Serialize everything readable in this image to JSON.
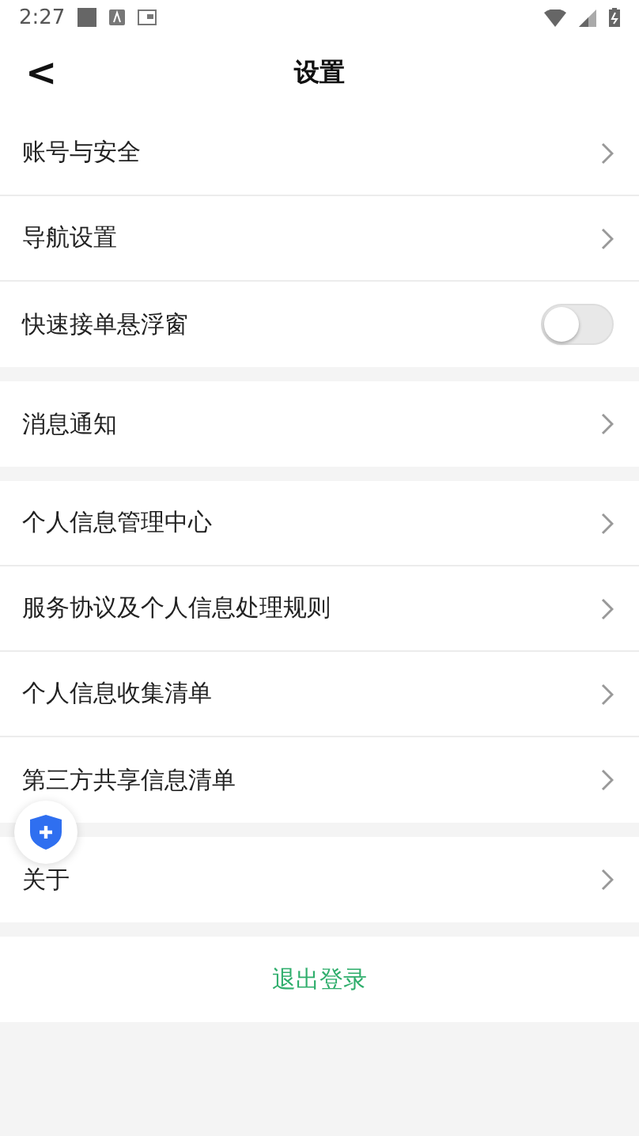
{
  "status_bar": {
    "time": "2:27"
  },
  "header": {
    "title": "设置",
    "back": "<"
  },
  "groups": [
    {
      "items": [
        {
          "label": "账号与安全",
          "kind": "link"
        },
        {
          "label": "导航设置",
          "kind": "link"
        },
        {
          "label": "快速接单悬浮窗",
          "kind": "toggle",
          "on": false
        }
      ]
    },
    {
      "items": [
        {
          "label": "消息通知",
          "kind": "link"
        }
      ]
    },
    {
      "items": [
        {
          "label": "个人信息管理中心",
          "kind": "link"
        },
        {
          "label": "服务协议及个人信息处理规则",
          "kind": "link"
        },
        {
          "label": "个人信息收集清单",
          "kind": "link"
        },
        {
          "label": "第三方共享信息清单",
          "kind": "link"
        }
      ]
    },
    {
      "items": [
        {
          "label": "关于",
          "kind": "link"
        }
      ]
    }
  ],
  "logout": "退出登录"
}
